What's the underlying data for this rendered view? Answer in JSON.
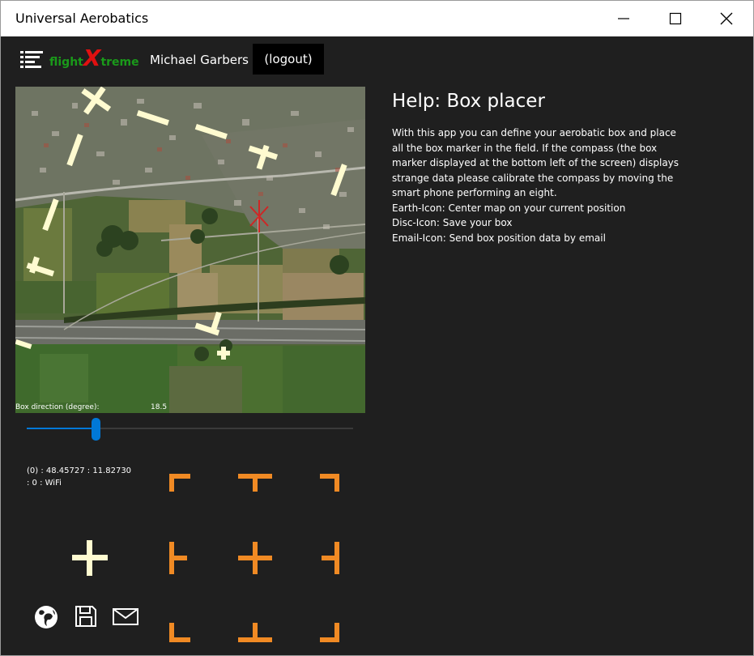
{
  "window": {
    "title": "Universal Aerobatics",
    "controls": {
      "minimize": "minimize-icon",
      "maximize": "maximize-icon",
      "close": "close-icon"
    }
  },
  "appbar": {
    "menu_icon": "hamburger-menu-icon",
    "logo": {
      "text_a": "flight",
      "text_x": "X",
      "text_b": "treme"
    },
    "username": "Michael Garbers",
    "logout_label": "(logout)"
  },
  "map": {
    "box_direction_label": "Box direction (degree):",
    "box_direction_value": "18.5",
    "slider": {
      "value": 18.5,
      "accent": "#0078d7"
    }
  },
  "status": {
    "line1": "(0) : 48.45727 : 11.82730",
    "line2": ": 0 : WiFi"
  },
  "help": {
    "title": "Help: Box placer",
    "lines": [
      "With this app you can define your aerobatic box and place",
      "all the box marker in the field. If the compass (the box",
      "marker displayed at the bottom left of the screen) displays",
      "strange data please calibrate the compass by moving the",
      "smart phone performing an eight.",
      "Earth-Icon: Center map on your current position",
      "Disc-Icon: Save your box",
      "Email-Icon: Send box position data by email"
    ]
  },
  "toolbar": {
    "icons": [
      "globe-icon",
      "save-disc-icon",
      "email-icon"
    ]
  },
  "colors": {
    "background": "#1f1f1f",
    "marker_orange": "#f08a24",
    "marker_cream": "#fffbd0",
    "slider_blue": "#0078d7"
  }
}
